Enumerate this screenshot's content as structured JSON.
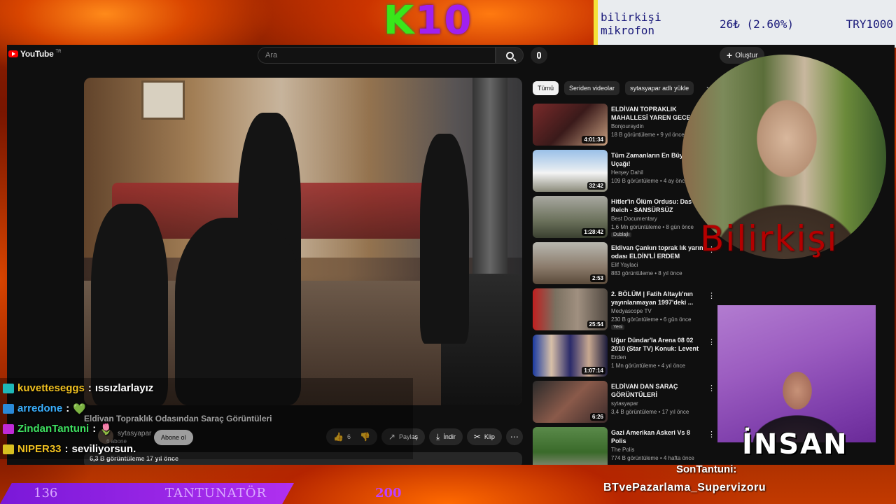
{
  "overlay": {
    "brand_k": "K",
    "brand_num": "10",
    "ticker": {
      "name": "bilirkişi mikrofon",
      "value": "26₺ (2.60%)",
      "currency": "TRY1000"
    },
    "cam1_label": "Bilirkişi",
    "cam2_label": "İNSAN",
    "last_title": "SonTantuni:",
    "last_name": "BTvePazarlama_Supervizoru",
    "goal": {
      "current": "136",
      "name": "TANTUNATÖR",
      "target": "200"
    }
  },
  "youtube": {
    "logo": "YouTube",
    "logo_tr": "TR",
    "search_placeholder": "Ara",
    "create_label": "Oluştur",
    "video": {
      "title": "Eldivan Topraklık Odasından Saraç Görüntüleri",
      "channel": "sytasyapar",
      "subs": "6 abone",
      "subscribe_label": "Abone ol",
      "likes": "6",
      "share_label": "Paylaş",
      "download_label": "İndir",
      "clip_label": "Klip",
      "description_meta": "6,3 B görüntüleme  17 yıl önce"
    },
    "chips": [
      "Tümü",
      "Seriden videolar",
      "sytasyapar adlı yükle"
    ],
    "sidebar": [
      {
        "title": "ELDİVAN TOPRAKLIK MAHALLESİ YAREN GECESİ",
        "channel": "Bonjouraydin",
        "meta": "18 B görüntüleme • 9 yıl önce",
        "duration": "4:01:34",
        "badge": ""
      },
      {
        "title": "Tüm Zamanların En Büyük Uçağı!",
        "channel": "Herşey Dahil",
        "meta": "109 B görüntüleme • 4 ay önce",
        "duration": "32:42",
        "badge": ""
      },
      {
        "title": "Hitler'in Ölüm Ordusu: Das Reich - SANSÜRSÜZ",
        "channel": "Best Documentary",
        "meta": "1,6 Mn görüntüleme • 8 gün önce",
        "duration": "1:28:42",
        "badge": "Dublajlı"
      },
      {
        "title": "Eldivan Çankırı toprak lık yarın odası ELDİN'Lİ ERDEM",
        "channel": "Elif Yaylaci",
        "meta": "883 görüntüleme • 8 yıl önce",
        "duration": "2:53",
        "badge": ""
      },
      {
        "title": "2. BÖLÜM | Fatih Altaylı'nın yayınlanmayan 1997'deki ...",
        "channel": "Medyascope TV",
        "meta": "230 B görüntüleme • 6 gün önce",
        "duration": "25:54",
        "badge": "Yeni"
      },
      {
        "title": "Uğur Dündar'la Arena 08 02 2010 (Star TV) Konuk: Levent ...",
        "channel": "Erden",
        "meta": "1 Mn görüntüleme • 4 yıl önce",
        "duration": "1:07:14",
        "badge": ""
      },
      {
        "title": "ELDİVAN DAN SARAÇ GÖRÜNTÜLERİ",
        "channel": "sytasyapar",
        "meta": "3,4 B görüntüleme • 17 yıl önce",
        "duration": "6:26",
        "badge": ""
      },
      {
        "title": "Gazi Amerikan Askeri Vs 8 Polis",
        "channel": "The Polis",
        "meta": "774 B görüntüleme • 4 hafta önce",
        "duration": "",
        "badge": ""
      }
    ]
  },
  "chat": [
    {
      "user": "kuvetteseggs",
      "sep": ":",
      "msg": "ıssızlarlayız",
      "user_color": "#f0c020",
      "badge_color": "#1fb8b8"
    },
    {
      "user": "arredone",
      "sep": ":",
      "msg": "💚",
      "user_color": "#3ab0ff",
      "badge_color": "#2a8ad8"
    },
    {
      "user": "ZindanTantuni",
      "sep": ":",
      "msg": "🌷",
      "user_color": "#3ee060",
      "badge_color": "#c02ad8"
    },
    {
      "user": "NIPER33",
      "sep": ":",
      "msg": "seviliyorsun.",
      "user_color": "#f0c020",
      "badge_color": "#d8c020"
    }
  ]
}
